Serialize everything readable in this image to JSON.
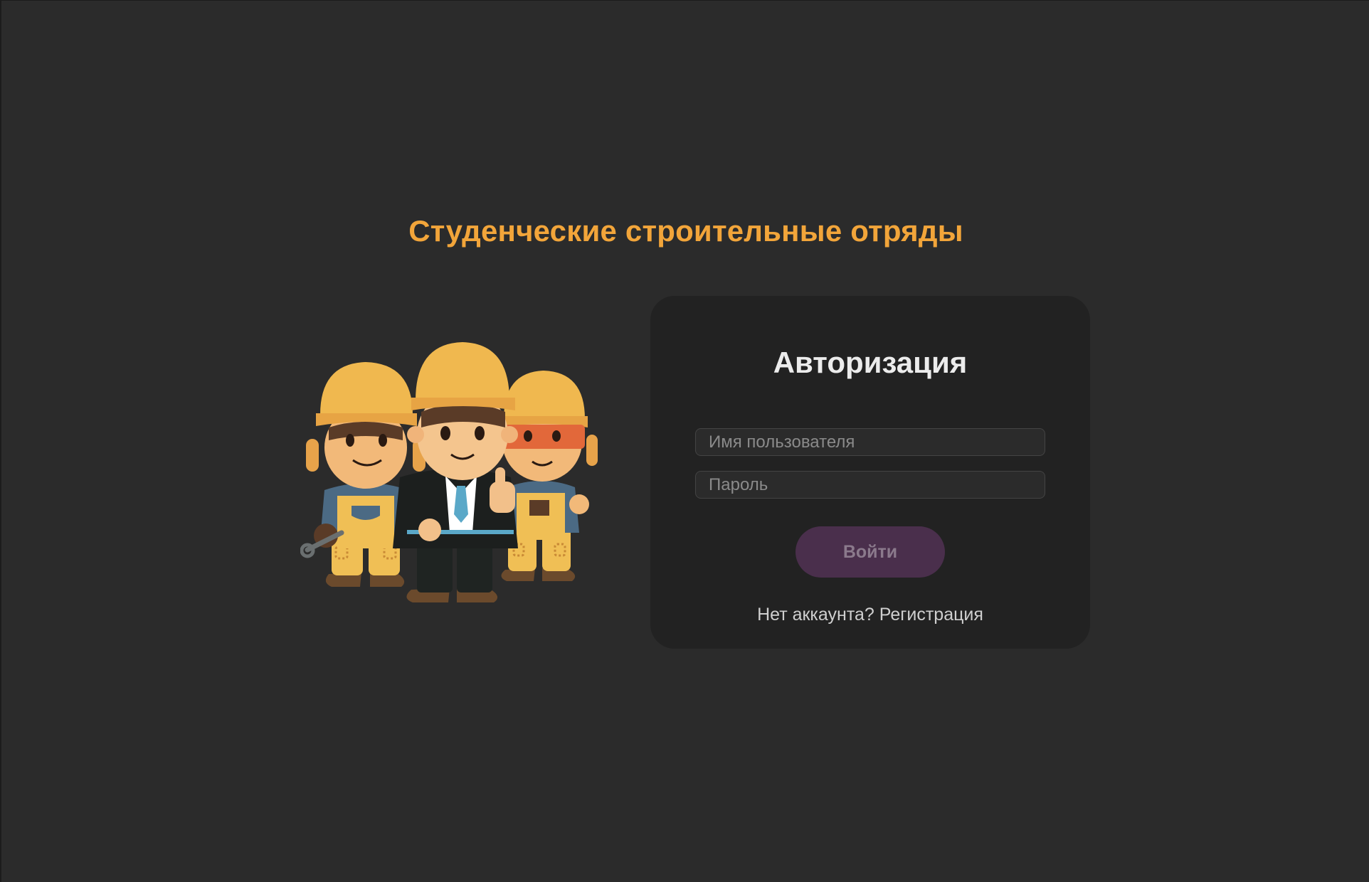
{
  "page": {
    "title": "Студенческие строительные отряды"
  },
  "auth_card": {
    "title": "Авторизация",
    "username_placeholder": "Имя пользователя",
    "username_value": "",
    "password_placeholder": "Пароль",
    "password_value": "",
    "login_label": "Войти",
    "no_account_text": "Нет аккаунта?",
    "register_label": "Регистрация"
  },
  "colors": {
    "background": "#2b2b2b",
    "card_background": "#222222",
    "title_accent": "#f2a53a",
    "button_background": "#4a2f4c",
    "button_text": "#8b7a8c"
  },
  "illustration": {
    "icon": "construction-workers-illustration"
  }
}
